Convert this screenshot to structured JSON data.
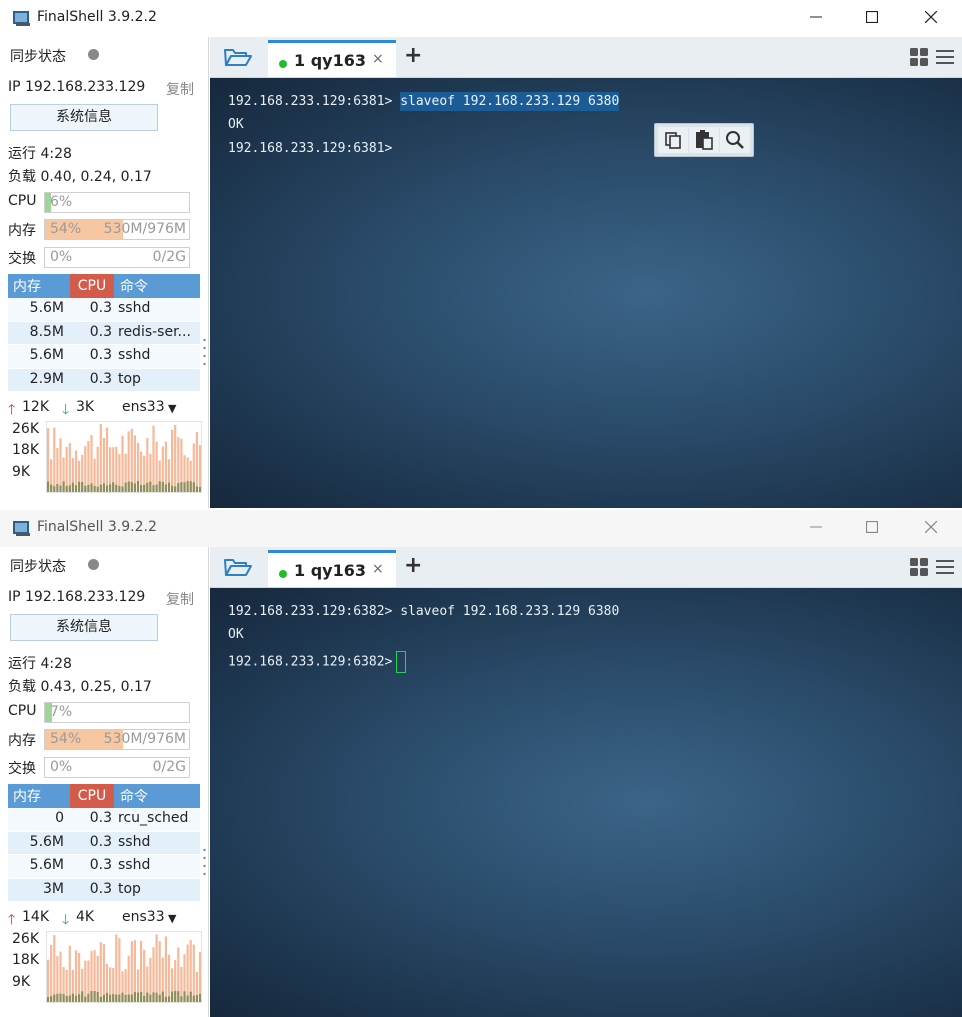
{
  "windows": [
    {
      "title": "FinalShell 3.9.2.2",
      "sidebar": {
        "sync_label": "同步状态",
        "ip": "IP 192.168.233.129",
        "copy": "复制",
        "sysinfo_button": "系统信息",
        "uptime": "运行 4:28",
        "load": "负载 0.40, 0.24, 0.17",
        "cpu_label": "CPU",
        "cpu_value": "6%",
        "cpu_fraction": 0.06,
        "mem_label": "内存",
        "mem_percent": "54%",
        "mem_usage": "530M/976M",
        "mem_fraction": 0.54,
        "swap_label": "交换",
        "swap_percent": "0%",
        "swap_usage": "0/2G",
        "proc_headers": {
          "mem": "内存",
          "cpu": "CPU",
          "cmd": "命令"
        },
        "processes": [
          {
            "mem": "5.6M",
            "cpu": "0.3",
            "cmd": "sshd"
          },
          {
            "mem": "8.5M",
            "cpu": "0.3",
            "cmd": "redis-ser..."
          },
          {
            "mem": "5.6M",
            "cpu": "0.3",
            "cmd": "sshd"
          },
          {
            "mem": "2.9M",
            "cpu": "0.3",
            "cmd": "top"
          }
        ],
        "net_up": "12K",
        "net_down": "3K",
        "net_iface": "ens33",
        "graph_labels": [
          "26K",
          "18K",
          "9K"
        ]
      },
      "tab": {
        "label": "1 qy163",
        "close": "×"
      },
      "terminal": {
        "line1_prompt": "192.168.233.129:6381> ",
        "line1_cmd": "slaveof 192.168.233.129 6380",
        "line2": "OK",
        "line3_prompt": "192.168.233.129:6381>"
      }
    },
    {
      "title": "FinalShell 3.9.2.2",
      "sidebar": {
        "sync_label": "同步状态",
        "ip": "IP 192.168.233.129",
        "copy": "复制",
        "sysinfo_button": "系统信息",
        "uptime": "运行 4:28",
        "load": "负载 0.43, 0.25, 0.17",
        "cpu_label": "CPU",
        "cpu_value": "7%",
        "cpu_fraction": 0.07,
        "mem_label": "内存",
        "mem_percent": "54%",
        "mem_usage": "530M/976M",
        "mem_fraction": 0.54,
        "swap_label": "交换",
        "swap_percent": "0%",
        "swap_usage": "0/2G",
        "proc_headers": {
          "mem": "内存",
          "cpu": "CPU",
          "cmd": "命令"
        },
        "processes": [
          {
            "mem": "0",
            "cpu": "0.3",
            "cmd": "rcu_sched"
          },
          {
            "mem": "5.6M",
            "cpu": "0.3",
            "cmd": "sshd"
          },
          {
            "mem": "5.6M",
            "cpu": "0.3",
            "cmd": "sshd"
          },
          {
            "mem": "3M",
            "cpu": "0.3",
            "cmd": "top"
          }
        ],
        "net_up": "14K",
        "net_down": "4K",
        "net_iface": "ens33",
        "graph_labels": [
          "26K",
          "18K",
          "9K"
        ]
      },
      "tab": {
        "label": "1 qy163",
        "close": "×"
      },
      "terminal": {
        "line1_prompt": "192.168.233.129:6382> ",
        "line1_cmd": "slaveof 192.168.233.129 6380",
        "line2": "OK",
        "line3_prompt": "192.168.233.129:6382>"
      }
    }
  ],
  "icons": {
    "app": "finalshell-app-icon",
    "folder": "folder-open-icon",
    "copy": "copy-icon",
    "paste": "paste-icon",
    "search": "search-icon",
    "grid": "grid-icon",
    "menu": "menu-icon"
  },
  "colors": {
    "tab_accent": "#2d8ad6",
    "online_dot": "#1fbf2b",
    "cpu_fill": "#9fd49a",
    "mem_fill": "#f7c7a2",
    "proc_header": "#5b9bd5",
    "proc_cpu_header": "#d25b49",
    "net_up": "#c0392b",
    "net_down": "#27ae60",
    "selection": "#1b5c96",
    "cursor": "#22d15a"
  }
}
